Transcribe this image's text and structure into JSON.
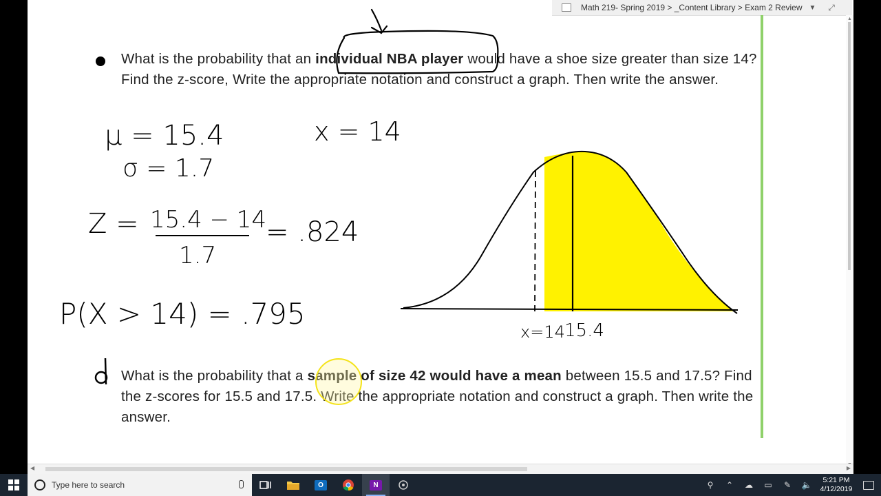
{
  "breadcrumb": {
    "text": "Math 219- Spring 2019 > _Content Library > Exam 2 Review"
  },
  "question_c": {
    "parts": [
      "What is the probability that an ",
      "individual NBA player",
      " would have a shoe size greater than size 14? Find the z-score, Write the appropriate notation and construct a graph. Then write the answer."
    ]
  },
  "question_d": {
    "parts": [
      "What is the probability that a ",
      "sample of size 42 would have a mean",
      " between 15.5 and 17.5? Find the z-scores for 15.5 and 17.5.  Write the appropriate notation and construct a graph. Then write the answer."
    ]
  },
  "ink": {
    "mu": "μ = 15.4",
    "sigma": "σ = 1.7",
    "x": "x = 14",
    "z_label": "Z =",
    "z_num": "15.4 − 14",
    "z_den": "1.7",
    "z_result": "= .824",
    "prob": "P(X > 14) = .795",
    "graph_x_label": "x=14",
    "graph_mean_label": "15.4"
  },
  "colors": {
    "highlight": "#fff200",
    "cursor_ring": "#f4e31a",
    "accent_green": "#8fd16a",
    "taskbar": "#1b2531"
  },
  "taskbar": {
    "search_placeholder": "Type here to search",
    "time": "5:21 PM",
    "date": "4/12/2019",
    "apps": [
      "task-view-icon",
      "file-explorer-icon",
      "outlook-icon",
      "chrome-icon",
      "onenote-icon",
      "media-icon"
    ]
  }
}
